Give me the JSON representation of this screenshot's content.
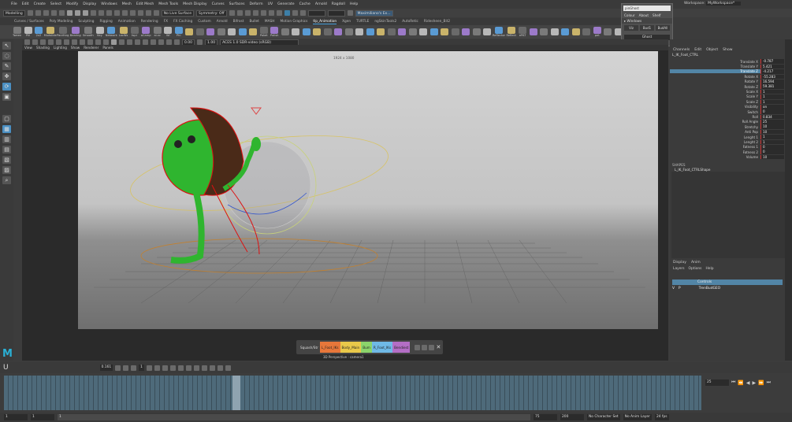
{
  "menubar": {
    "items": [
      "File",
      "Edit",
      "Create",
      "Select",
      "Modify",
      "Display",
      "Windows",
      "Mesh",
      "Edit Mesh",
      "Mesh Tools",
      "Mesh Display",
      "Curves",
      "Surfaces",
      "Deform",
      "UV",
      "Generate",
      "Cache",
      "Arnold",
      "Ragdoll",
      "Help"
    ]
  },
  "statusline": {
    "mode": "Modelling",
    "surface": "No Live Surface",
    "symmetry": "Symmetry: Off",
    "character": "Maximiliano's Ex..."
  },
  "shelf": {
    "tabs": [
      "Curves / Surfaces",
      "Poly Modeling",
      "Sculpting",
      "Rigging",
      "Animation",
      "Rendering",
      "FX",
      "FX Caching",
      "Custom",
      "Arnold",
      "Bifrost",
      "Bullet",
      "MASH",
      "Motion Graphics",
      "tlp_Animation",
      "Xgen",
      "TURTLE",
      "ngSkinTools2",
      "AutoRetic",
      "Ridesheen_Bit2"
    ],
    "active_tab": "tlp_Animation",
    "buttons": [
      "Tween",
      "Pill",
      "2x2",
      "Mudslide",
      "Pacdhng",
      "Bearing",
      "Smooth",
      "Key",
      "Network",
      "LocWs",
      "tspr",
      "aCamp",
      "ai.nc",
      "Wi",
      "Phi",
      "",
      "",
      "",
      "",
      "",
      "",
      "",
      "Paket",
      "Polish",
      "",
      "",
      "",
      "",
      "",
      "",
      "",
      "",
      "",
      "",
      "",
      "",
      "",
      "",
      "",
      "",
      "",
      "",
      "",
      "",
      "Reflector",
      "Reflect",
      "ePAT",
      "",
      "",
      "",
      "",
      "",
      "",
      "pet",
      "",
      ""
    ]
  },
  "viewport": {
    "menus": [
      "View",
      "Shading",
      "Lighting",
      "Show",
      "Renderer",
      "Panels"
    ],
    "exposure": "0.00",
    "gamma": "1.00",
    "colorspace": "ACES 1.0 SDR-video (sRGB)",
    "resolution_gate": "1924 x 1080",
    "camera_label": "3D Perspective : camera1"
  },
  "picker": {
    "label": "Squash/Str",
    "buttons": [
      {
        "label": "L_Foot_IKs",
        "color": "#e8773a"
      },
      {
        "label": "Body_Main",
        "color": "#e9c84a"
      },
      {
        "label": "Bum",
        "color": "#8bd46b"
      },
      {
        "label": "R_Foot_IKs",
        "color": "#6fb9e6"
      },
      {
        "label": "Bendiest",
        "color": "#b46ec5"
      }
    ],
    "close": "✕"
  },
  "ghost_window": {
    "input": "pinGhost",
    "menus": [
      "Colour",
      "About",
      "Shelf"
    ],
    "windows_label": "Windows",
    "mini_buttons": [
      "Viz",
      "Bud1",
      "BudAll"
    ],
    "button": "Ghost"
  },
  "workspace": {
    "label": "Workspace:",
    "value": "MyWorkspace*"
  },
  "channelbox": {
    "tabs": [
      "Channels",
      "Edit",
      "Object",
      "Show"
    ],
    "object": "L_IK_Foot_CTRL",
    "attrs": [
      {
        "name": "Translate X",
        "value": "-0.787"
      },
      {
        "name": "Translate Y",
        "value": "5.421"
      },
      {
        "name": "Translate Z",
        "value": "-4.217"
      },
      {
        "name": "Rotate X",
        "value": "-55.283"
      },
      {
        "name": "Rotate Y",
        "value": "16.594"
      },
      {
        "name": "Rotate Z",
        "value": "59.381"
      },
      {
        "name": "Scale X",
        "value": "1"
      },
      {
        "name": "Scale Y",
        "value": "1"
      },
      {
        "name": "Scale Z",
        "value": "1"
      },
      {
        "name": "Visibility",
        "value": "on"
      },
      {
        "name": "Switch",
        "value": "0"
      },
      {
        "name": "Roll",
        "value": "0.834"
      },
      {
        "name": "Roll Angle",
        "value": "25"
      },
      {
        "name": "Stretchy",
        "value": "10"
      },
      {
        "name": "Anti Pop",
        "value": "10"
      },
      {
        "name": "Lenght 1",
        "value": "1"
      },
      {
        "name": "Lenght 2",
        "value": "1"
      },
      {
        "name": "Fatness 1",
        "value": "0"
      },
      {
        "name": "Fatness 2",
        "value": "0"
      },
      {
        "name": "Volume",
        "value": "10"
      }
    ],
    "shapes_header": "SHAPES",
    "shape": "L_IK_Foot_CTRLShape"
  },
  "layers": {
    "tabs": [
      "Display",
      "Anim"
    ],
    "menus": [
      "Layers",
      "Options",
      "Help"
    ],
    "rows": [
      {
        "v": "",
        "p": "",
        "name": "Controls",
        "selected": true
      },
      {
        "v": "V",
        "p": "P",
        "name": "TrenBudGEO",
        "selected": false
      }
    ]
  },
  "timeline": {
    "current_frame": "25",
    "frame_field": "0.161",
    "frame_field2": "1"
  },
  "range": {
    "start": "1",
    "start2": "1",
    "anim_start": "1",
    "end": "75",
    "anim_end": "200",
    "character_set": "No Character Set",
    "anim_layer": "No Anim Layer",
    "fps": "24 fps"
  }
}
